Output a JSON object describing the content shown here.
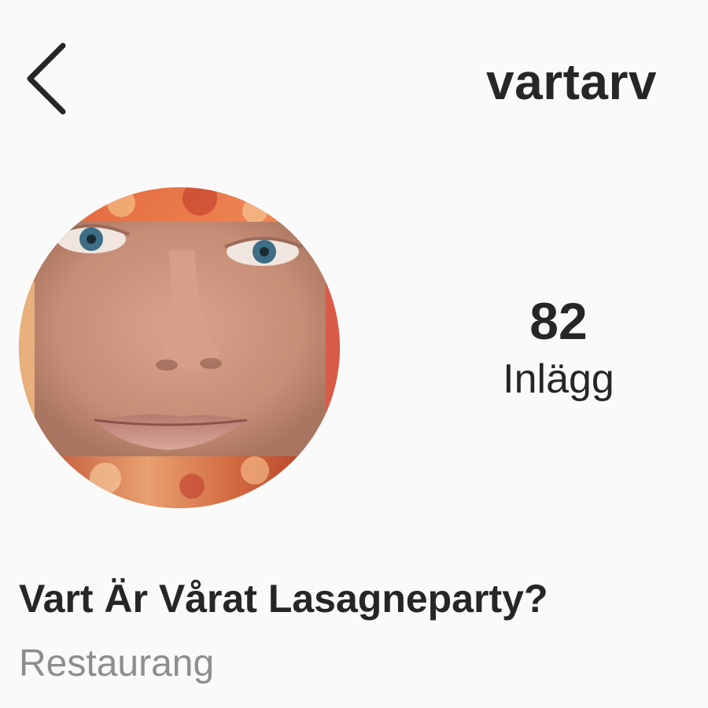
{
  "header": {
    "username": "vartarv",
    "back_icon": "chevron-left-icon"
  },
  "profile": {
    "avatar": "profile-picture",
    "stats": {
      "posts_count": "82",
      "posts_label": "Inlägg"
    },
    "display_name": "Vart Är Vårat Lasagneparty?",
    "category": "Restaurang"
  },
  "colors": {
    "background": "#fafafa",
    "text_primary": "#262626",
    "text_secondary": "#8e8e8e"
  }
}
